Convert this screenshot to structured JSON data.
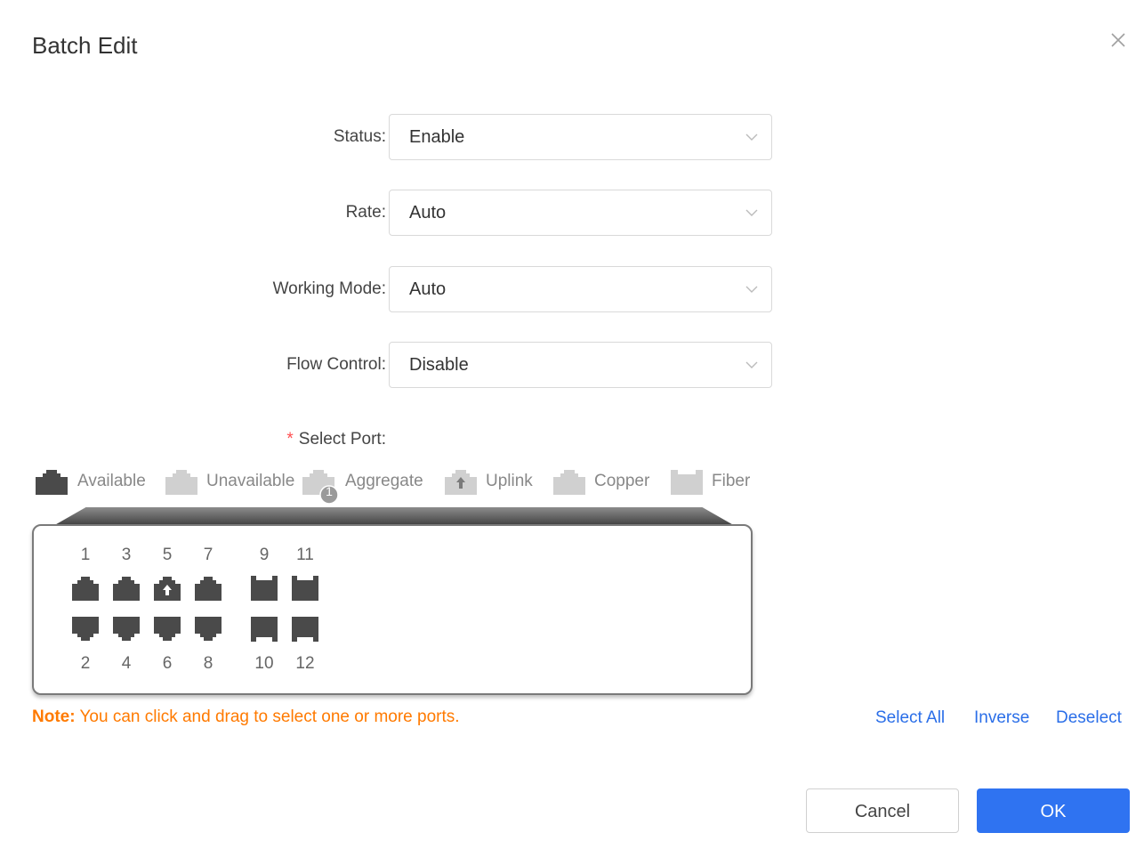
{
  "dialog": {
    "title": "Batch Edit",
    "close_icon": "close-icon"
  },
  "form": {
    "status": {
      "label": "Status:",
      "value": "Enable"
    },
    "rate": {
      "label": "Rate:",
      "value": "Auto"
    },
    "working_mode": {
      "label": "Working Mode:",
      "value": "Auto"
    },
    "flow_control": {
      "label": "Flow Control:",
      "value": "Disable"
    },
    "select_port": {
      "required_mark": "*",
      "label": "Select Port:"
    }
  },
  "legend": {
    "available": "Available",
    "unavailable": "Unavailable",
    "aggregate": "Aggregate",
    "aggregate_badge": "1",
    "uplink": "Uplink",
    "copper": "Copper",
    "fiber": "Fiber"
  },
  "colors": {
    "port_available": "#4a4a4a",
    "port_unavailable": "#d0d0d0",
    "link": "#2a6ee8",
    "primary": "#2f73f1",
    "note": "#ff7a00"
  },
  "ports": {
    "top_labels": [
      "1",
      "3",
      "5",
      "7",
      "9",
      "11"
    ],
    "bottom_labels": [
      "2",
      "4",
      "6",
      "8",
      "10",
      "12"
    ],
    "uplink_port": "5"
  },
  "note": {
    "label": "Note:",
    "text": " You can click and drag to select one or more ports."
  },
  "actions": {
    "select_all": "Select All",
    "inverse": "Inverse",
    "deselect": "Deselect"
  },
  "footer": {
    "cancel": "Cancel",
    "ok": "OK"
  }
}
